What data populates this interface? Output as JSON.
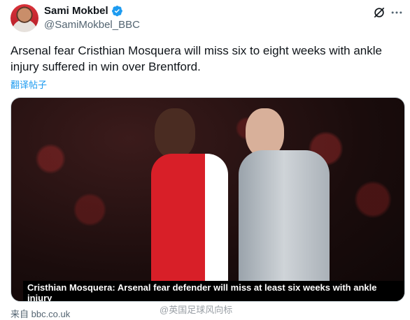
{
  "author": {
    "display_name": "Sami Mokbel",
    "handle": "@SamiMokbel_BBC",
    "verified": true
  },
  "tweet": {
    "text": "Arsenal fear Cristhian Mosquera will miss six to eight weeks with ankle injury suffered in win over Brentford.",
    "translate_label": "翻译帖子"
  },
  "media": {
    "caption": "Cristhian Mosquera: Arsenal fear defender will miss at least six weeks with ankle injury"
  },
  "source": {
    "label": "来自 bbc.co.uk"
  },
  "watermark": {
    "text": "@英国足球风向标"
  },
  "colors": {
    "accent": "#1d9bf0",
    "text": "#0f1419",
    "muted": "#536471"
  },
  "icons": {
    "verified": "verified-badge-icon",
    "grok": "grok-icon",
    "more": "more-icon"
  }
}
